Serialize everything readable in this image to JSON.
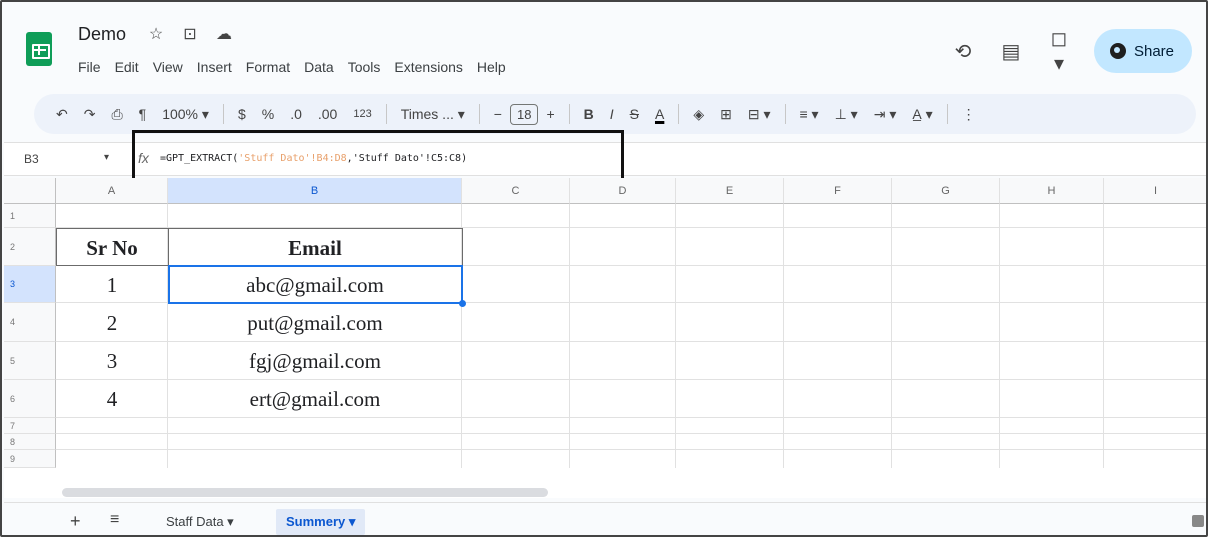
{
  "app": {
    "doc_title": "Demo",
    "menu": [
      "File",
      "Edit",
      "View",
      "Insert",
      "Format",
      "Data",
      "Tools",
      "Extensions",
      "Help"
    ],
    "share_label": "Share"
  },
  "toolbar": {
    "zoom": "100%",
    "currency": "$",
    "percent": "%",
    "dec_decrease": ".0",
    "dec_increase": ".00",
    "number_format": "123",
    "font": "Times ...",
    "minus": "−",
    "font_size": "18",
    "plus": "+",
    "bold": "B",
    "italic": "I",
    "strike": "S",
    "text_color": "A"
  },
  "formula_bar": {
    "cell_ref": "B3",
    "fx": "fx",
    "formula_prefix": "=GPT_EXTRACT(",
    "arg1": "'Stuff Dato'!B4:D8",
    "comma": ",",
    "arg2": "'Stuff Dato'!C5:C8",
    "formula_suffix": ")"
  },
  "grid": {
    "columns": [
      "A",
      "B",
      "C",
      "D",
      "E",
      "F",
      "G",
      "H",
      "I"
    ],
    "rows": [
      "1",
      "2",
      "3",
      "4",
      "5",
      "6",
      "7",
      "8",
      "9"
    ],
    "table": {
      "header_sr": "Sr No",
      "header_email": "Email",
      "rows": [
        {
          "sr": "1",
          "email": "abc@gmail.com"
        },
        {
          "sr": "2",
          "email": "put@gmail.com"
        },
        {
          "sr": "3",
          "email": "fgj@gmail.com"
        },
        {
          "sr": "4",
          "email": "ert@gmail.com"
        }
      ]
    }
  },
  "sheets": {
    "tabs": [
      {
        "label": "Staff Data ▾",
        "active": false
      },
      {
        "label": "Summery ▾",
        "active": true
      }
    ]
  }
}
